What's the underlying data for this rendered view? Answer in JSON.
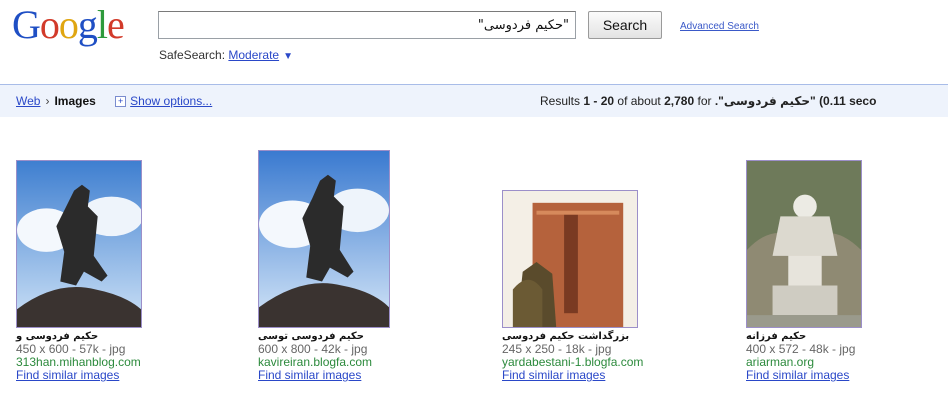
{
  "logo": "Google",
  "search": {
    "query": "\"حکیم فردوسی\"",
    "button": "Search",
    "advanced": "Advanced Search"
  },
  "safesearch": {
    "label": "SafeSearch:",
    "value": "Moderate"
  },
  "nav": {
    "web": "Web",
    "separator": "›",
    "images": "Images",
    "show_options": "Show options..."
  },
  "results": {
    "prefix": "Results",
    "range": "1 - 20",
    "of_about": "of about",
    "count": "2,780",
    "for_text": "for",
    "query": "\"حکیم فردوسی\".",
    "time": "(0.11 seco"
  },
  "images": [
    {
      "title": "حکیم فردوسی و",
      "size": "450 x 600 - 57k - jpg",
      "url": "313han.mihanblog.com",
      "similar": "Find similar images"
    },
    {
      "title": "حکیم فردوسی توسی",
      "size": "600 x 800 - 42k - jpg",
      "url": "kavireiran.blogfa.com",
      "similar": "Find similar images"
    },
    {
      "title": "بزرگداشت حکیم فردوسی",
      "size": "245 x 250 - 18k - jpg",
      "url": "yardabestani-1.blogfa.com",
      "similar": "Find similar images"
    },
    {
      "title": "حکیم فرزانه",
      "size": "400 x 572 - 48k - jpg",
      "url": "ariarman.org",
      "similar": "Find similar images"
    }
  ],
  "colors": {
    "link": "#2a48c8",
    "url_green": "#2c8a3c",
    "bar": "#eef3fc",
    "thumb_border": "#9c8fc9"
  }
}
